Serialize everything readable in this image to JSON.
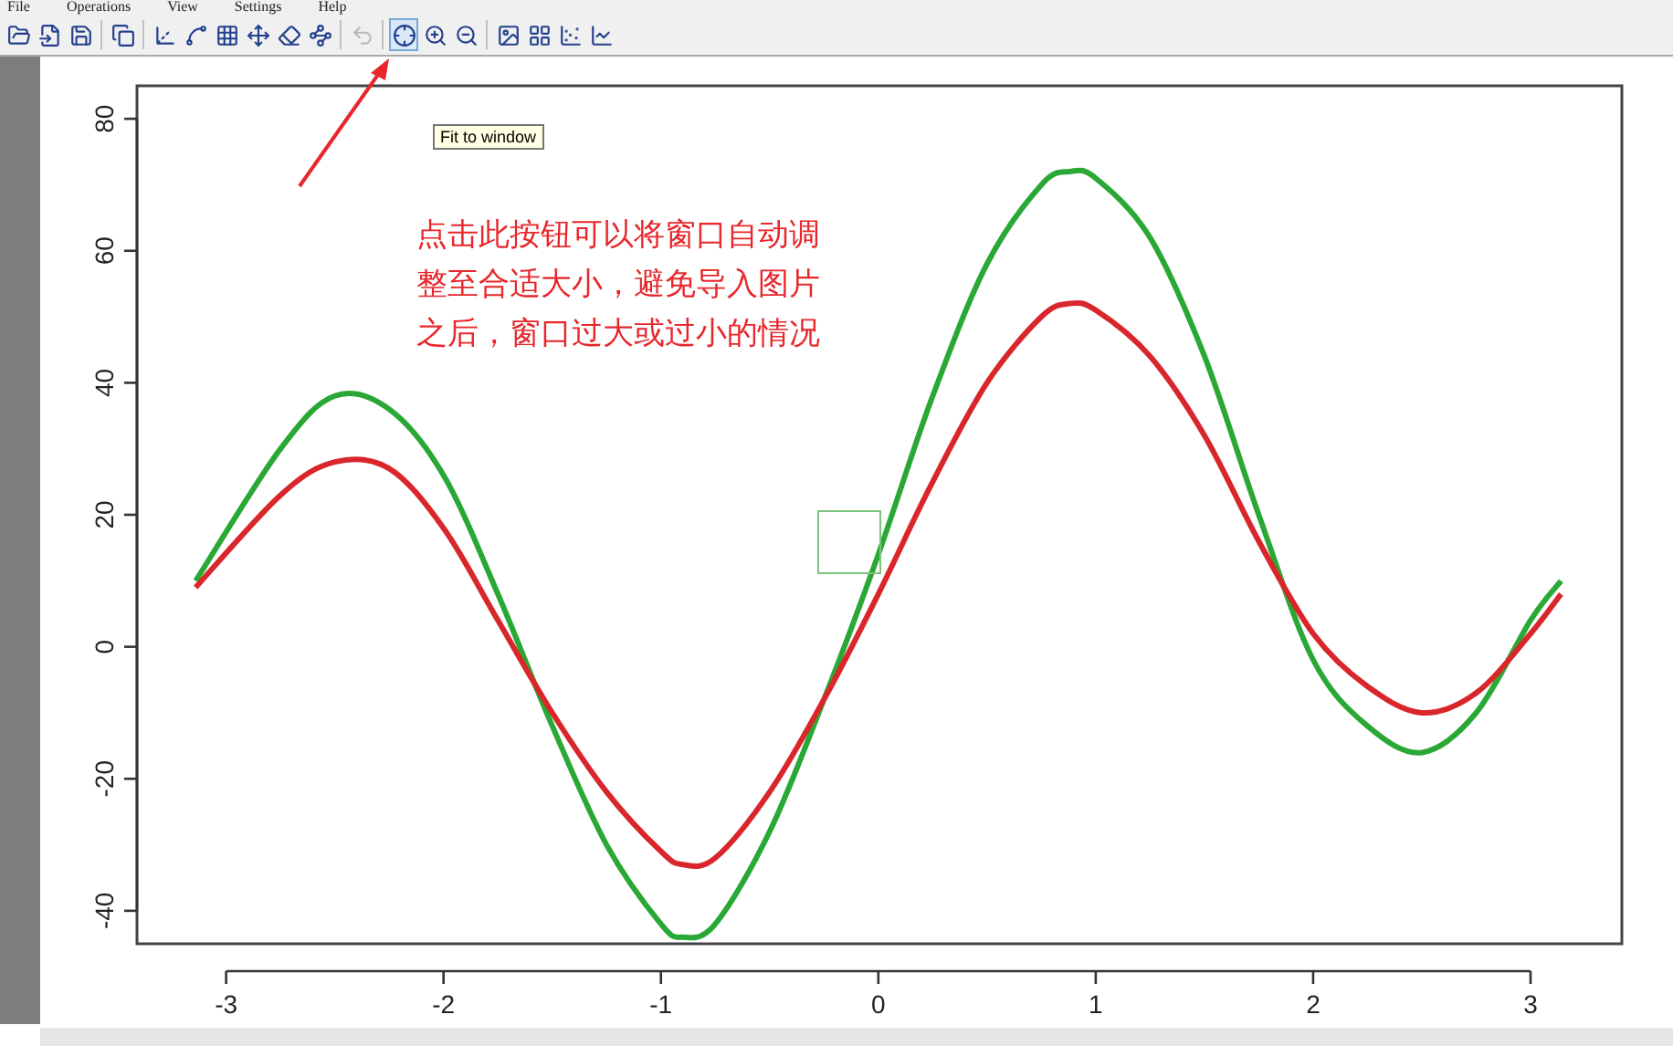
{
  "menu": [
    {
      "label": "File"
    },
    {
      "label": "Operations"
    },
    {
      "label": "View"
    },
    {
      "label": "Settings"
    },
    {
      "label": "Help"
    }
  ],
  "toolbar": [
    {
      "selected": false,
      "disabled": false
    },
    {
      "selected": false,
      "disabled": false
    },
    {
      "selected": false,
      "disabled": false
    },
    {
      "selected": false,
      "disabled": false
    },
    {
      "selected": false,
      "disabled": false
    },
    {
      "selected": false,
      "disabled": false
    },
    {
      "selected": false,
      "disabled": false
    },
    {
      "selected": false,
      "disabled": false
    },
    {
      "selected": false,
      "disabled": false
    },
    {
      "selected": false,
      "disabled": false
    },
    {
      "selected": false,
      "disabled": true
    },
    {
      "selected": true,
      "disabled": false
    },
    {
      "selected": false,
      "disabled": false
    },
    {
      "selected": false,
      "disabled": false
    },
    {
      "selected": false,
      "disabled": false
    },
    {
      "selected": false,
      "disabled": false
    },
    {
      "selected": false,
      "disabled": false
    },
    {
      "selected": false,
      "disabled": false
    }
  ],
  "tooltip": "Fit to window",
  "annotation": {
    "lines": [
      "点击此按钮可以将窗口自动调",
      "整至合适大小，避免导入图片",
      "之后，窗口过大或过小的情况"
    ]
  },
  "chart_data": {
    "type": "line",
    "x": [
      -3.14,
      -2.75,
      -2.5,
      -2.25,
      -2,
      -1.75,
      -1.5,
      -1.25,
      -1,
      -0.9,
      -0.75,
      -0.5,
      -0.25,
      0,
      0.25,
      0.5,
      0.75,
      0.88,
      1,
      1.25,
      1.5,
      1.75,
      2,
      2.25,
      2.5,
      2.75,
      3,
      3.14
    ],
    "series": [
      {
        "color": "#2aa836",
        "values": [
          10,
          30,
          38,
          36,
          26,
          8,
          -12,
          -30,
          -42,
          -44,
          -42,
          -28,
          -8,
          14,
          38,
          58,
          70,
          72,
          71,
          62,
          44,
          20,
          -2,
          -12,
          -16,
          -10,
          4,
          10
        ]
      },
      {
        "color": "#d9262b",
        "values": [
          9,
          23,
          28,
          27,
          18,
          4,
          -10,
          -22,
          -31,
          -33,
          -32,
          -22,
          -8,
          8,
          25,
          40,
          50,
          52,
          51,
          44,
          32,
          16,
          2,
          -6,
          -10,
          -7,
          2,
          8
        ]
      }
    ],
    "xlim": [
      -3.41,
      3.42
    ],
    "ylim": [
      -45,
      85
    ],
    "xticks": [
      {
        "value": -3,
        "label": "-3"
      },
      {
        "value": -2,
        "label": "-2"
      },
      {
        "value": -1,
        "label": "-1"
      },
      {
        "value": 0,
        "label": "0"
      },
      {
        "value": 1,
        "label": "1"
      },
      {
        "value": 2,
        "label": "2"
      },
      {
        "value": 3,
        "label": "3"
      }
    ],
    "yticks": [
      {
        "value": -40,
        "label": "-40"
      },
      {
        "value": -20,
        "label": "-20"
      },
      {
        "value": 0,
        "label": "0"
      },
      {
        "value": 20,
        "label": "20"
      },
      {
        "value": 40,
        "label": "40"
      },
      {
        "value": 60,
        "label": "60"
      },
      {
        "value": 80,
        "label": "80"
      }
    ]
  }
}
